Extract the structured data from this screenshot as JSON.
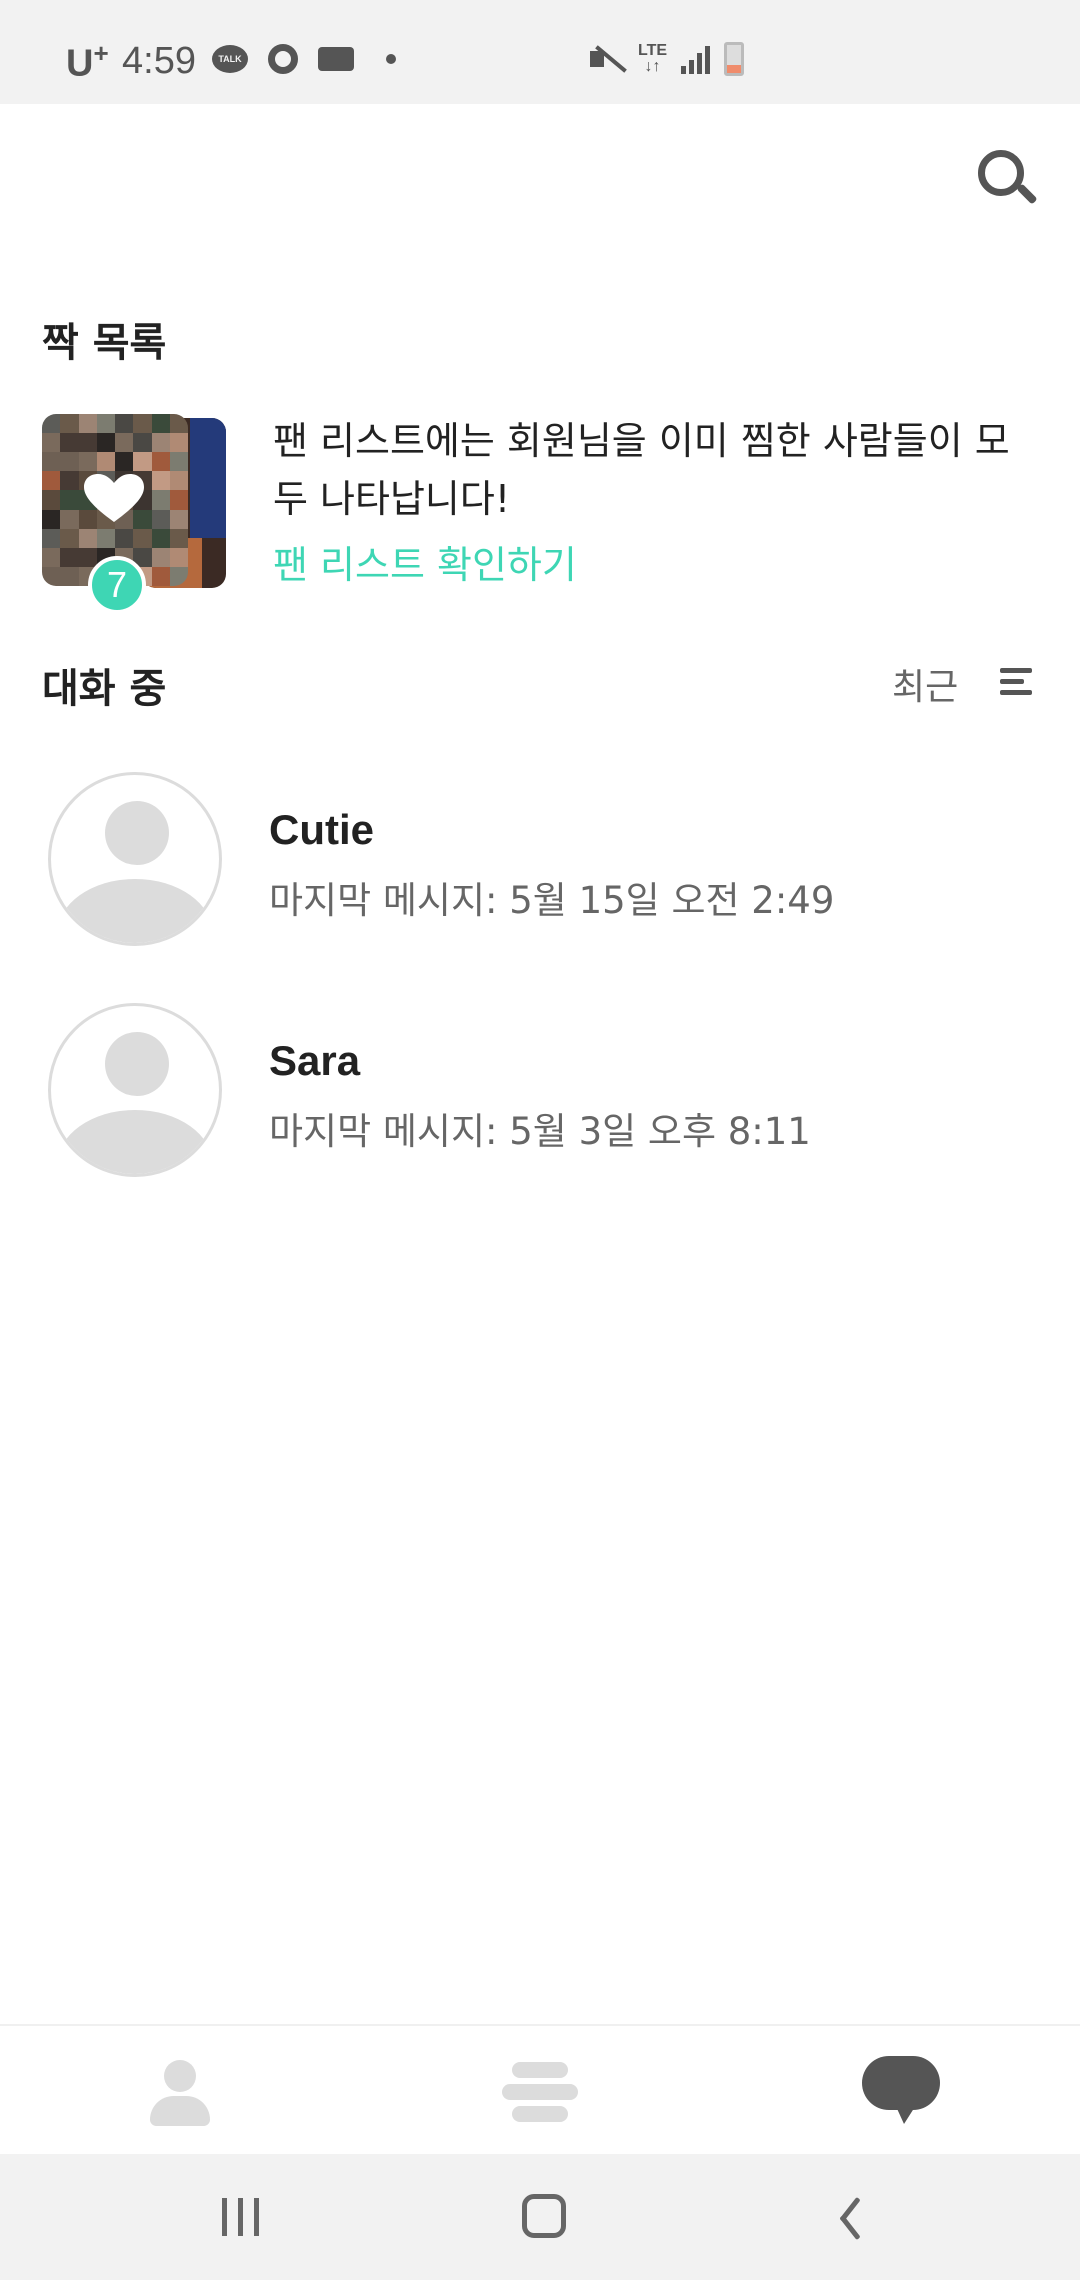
{
  "status_bar": {
    "carrier": "U",
    "carrier_sup": "+",
    "time": "4:59",
    "talk_icon_text": "TALK",
    "network": "LTE",
    "icons_left": [
      "kakaotalk-icon",
      "record-icon",
      "card-icon",
      "dot-icon"
    ],
    "icons_right": [
      "mute-icon",
      "lte-icon",
      "signal-icon",
      "battery-icon"
    ]
  },
  "header": {
    "search_icon": "search-icon"
  },
  "match_section": {
    "title": "짝 목록",
    "badge_count": "7",
    "description": "팬 리스트에는 회원님을 이미 찜한 사람들이 모두 나타납니다!",
    "link_label": "팬 리스트 확인하기",
    "accent_color": "#3ed6b4"
  },
  "conversations": {
    "title": "대화 중",
    "sort_label": "최근",
    "items": [
      {
        "name": "Cutie",
        "last_message": "마지막 메시지: 5월 15일 오전 2:49"
      },
      {
        "name": "Sara",
        "last_message": "마지막 메시지: 5월 3일 오후 8:11"
      }
    ]
  },
  "tab_bar": {
    "tabs": [
      {
        "icon": "profile-icon",
        "active": false
      },
      {
        "icon": "cards-stack-icon",
        "active": false
      },
      {
        "icon": "chat-bubble-icon",
        "active": true
      }
    ]
  },
  "nav_bar": {
    "buttons": [
      "recent-apps-icon",
      "home-icon",
      "back-icon"
    ]
  }
}
